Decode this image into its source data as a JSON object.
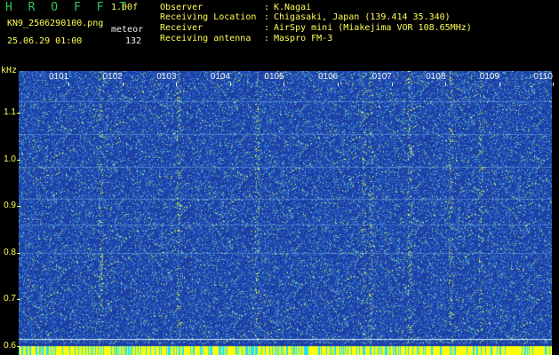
{
  "header": {
    "logo": "H R O F F T",
    "version": "1.00f",
    "filename": "KN9_2506290100.png",
    "meteor_label": "meteor",
    "datetime": "25.06.29 01:00",
    "meteor_count": "132"
  },
  "info": [
    {
      "label": "Observer",
      "colon": ":",
      "value": "K.Nagai"
    },
    {
      "label": "Receiving Location",
      "colon": ":",
      "value": "Chigasaki, Japan (139.414 35.340)"
    },
    {
      "label": "Receiver",
      "colon": ":",
      "value": "AirSpy mini (Miakejima VOR 108.65MHz)"
    },
    {
      "label": "Receiving antenna",
      "colon": ":",
      "value": "Maspro FM-3"
    }
  ],
  "chart_data": {
    "type": "heatmap",
    "ylabel": "kHz",
    "yticks": [
      "1.1",
      "1.0",
      "0.9",
      "0.8",
      "0.7",
      "0.6"
    ],
    "ylim": [
      0.58,
      1.19
    ],
    "xticks": [
      "0101",
      "0102",
      "0103",
      "0104",
      "0105",
      "0106",
      "0107",
      "0108",
      "0109",
      "0110"
    ],
    "colors": {
      "background": "#1a3a9e",
      "noise_light": "#3a88d8",
      "noise_bright": "#e8ff40",
      "reference_line": "#c8e8f0",
      "bottom_bar_a": "#ffff00",
      "bottom_bar_b": "#20e0ff"
    }
  }
}
